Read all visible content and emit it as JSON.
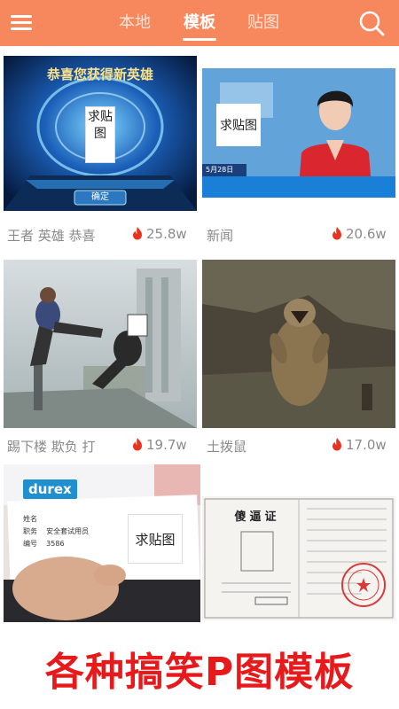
{
  "header": {
    "tabs": [
      {
        "label": "本地"
      },
      {
        "label": "模板"
      },
      {
        "label": "贴图"
      }
    ],
    "active_tab_index": 1,
    "bar_color": "#f7875c",
    "icons": {
      "menu": "menu-icon",
      "search": "search-icon"
    }
  },
  "templates": [
    {
      "title": "王者 英雄 恭喜",
      "hot": "25.8w",
      "overlay_text": "恭喜您获得新英雄",
      "paste_label": "求贴图",
      "button_text": "确定"
    },
    {
      "title": "新闻",
      "hot": "20.6w",
      "paste_label": "求贴图",
      "ticker_text": "5月28日"
    },
    {
      "title": "踢下楼 欺负 打",
      "hot": "19.7w"
    },
    {
      "title": "土拨鼠",
      "hot": "17.0w"
    },
    {
      "brand_text": "durex",
      "name_label": "姓名",
      "role_label": "职务",
      "role_value": "安全套试用员",
      "id_label": "编号",
      "id_value": "3586",
      "paste_label": "求贴图"
    },
    {
      "doc_title": "傻逼证"
    }
  ],
  "hot_icon": "flame-icon",
  "banner": {
    "text": "各种搞笑P图模板",
    "color": "#e8191b"
  }
}
